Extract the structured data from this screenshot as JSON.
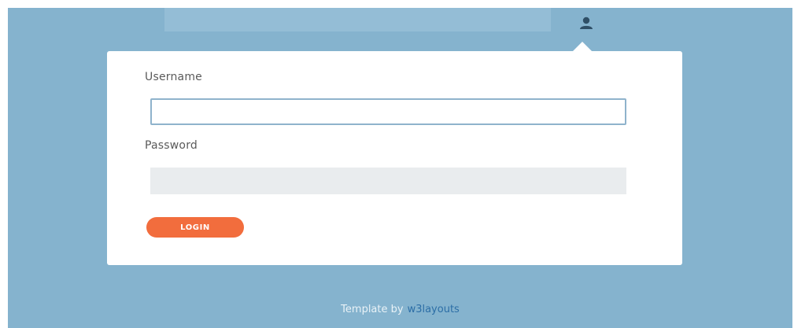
{
  "header": {
    "user_icon": "user-icon"
  },
  "login_form": {
    "username_label": "Username",
    "username_value": "",
    "username_placeholder": "",
    "password_label": "Password",
    "password_value": "",
    "password_placeholder": "",
    "login_button_label": "LOGIN"
  },
  "footer": {
    "text": "Template by",
    "link_text": "w3layouts"
  },
  "colors": {
    "background": "#85b3ce",
    "panel": "#ffffff",
    "accent_button": "#f26d3d",
    "link": "#2c6ea6"
  }
}
